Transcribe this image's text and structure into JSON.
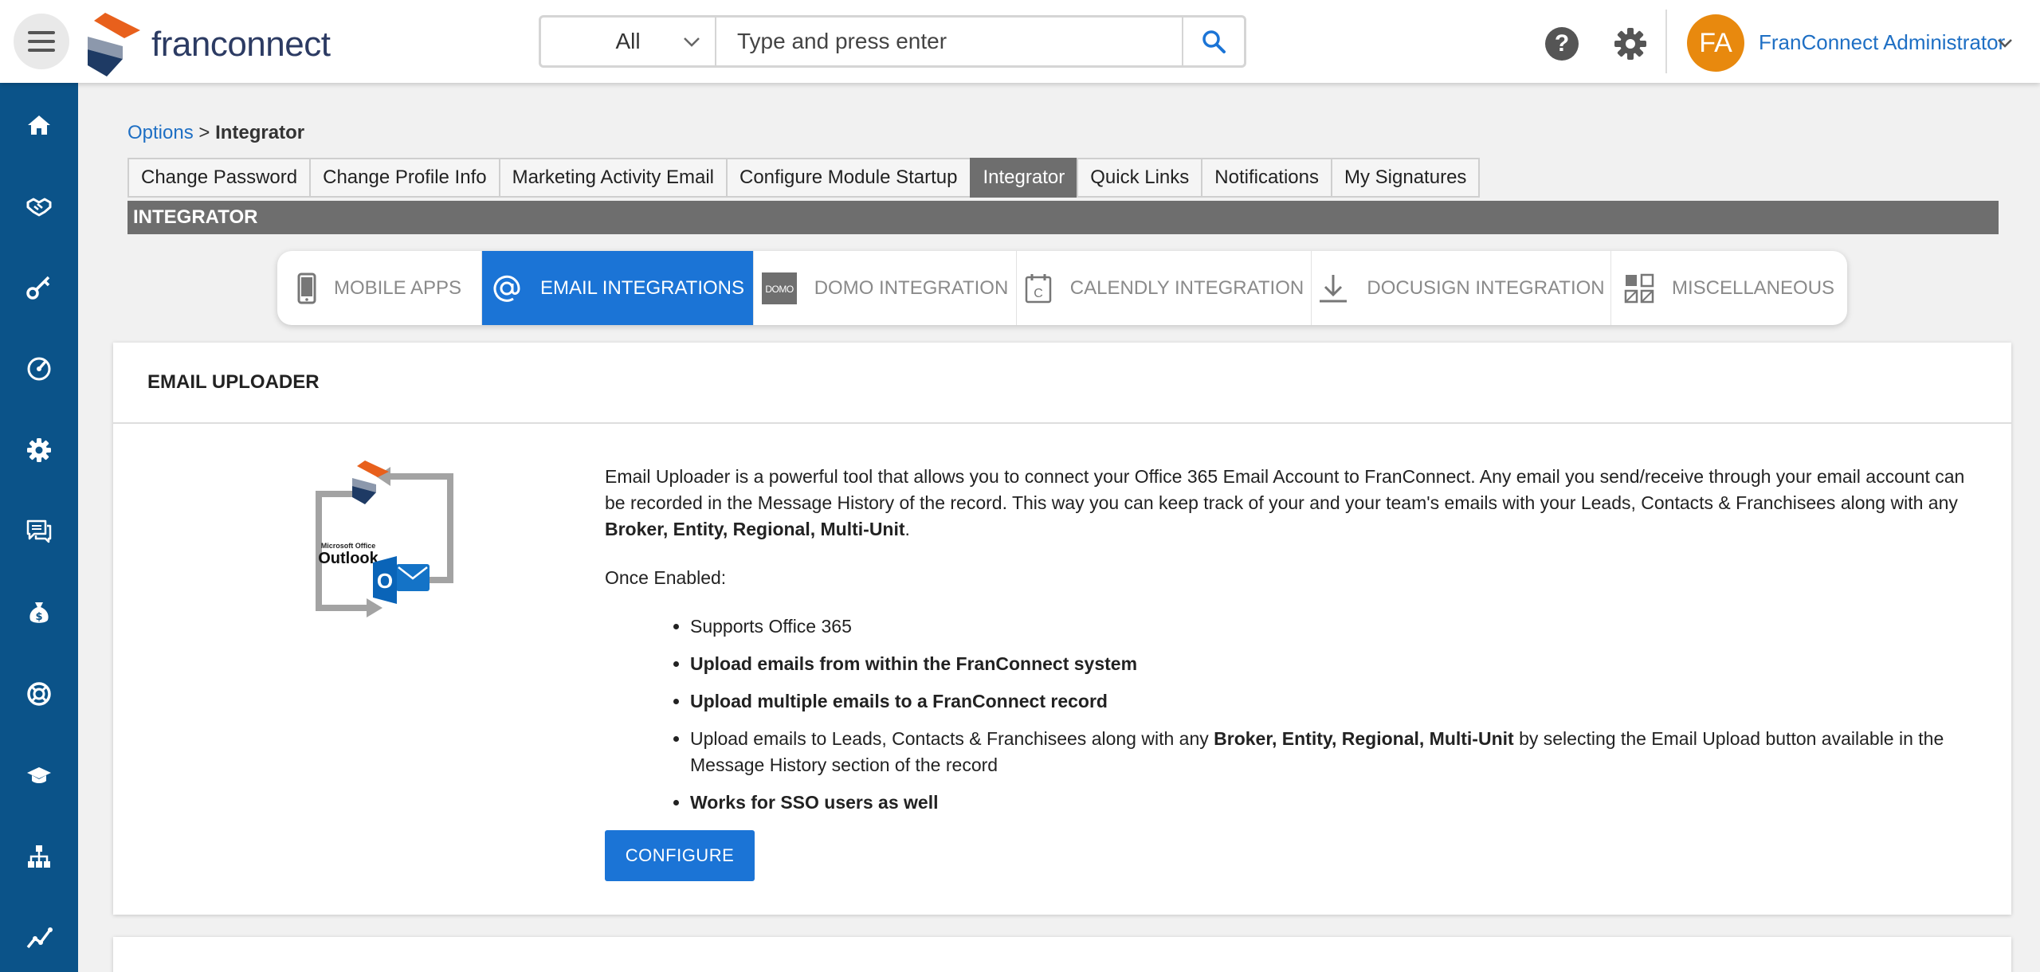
{
  "header": {
    "logo_text": "franconnect",
    "search": {
      "scope_value": "All",
      "placeholder": "Type and press enter"
    },
    "user": {
      "initials": "FA",
      "name": "FranConnect Administrator",
      "avatar_color": "#e8890e"
    }
  },
  "sidebar": {
    "color": "#0b5389",
    "items": [
      {
        "icon": "home-icon"
      },
      {
        "icon": "handshake-icon"
      },
      {
        "icon": "key-icon"
      },
      {
        "icon": "dashboard-gauge-icon"
      },
      {
        "icon": "gear-icon"
      },
      {
        "icon": "chat-icon"
      },
      {
        "icon": "money-bag-icon"
      },
      {
        "icon": "support-lifebuoy-icon"
      },
      {
        "icon": "graduation-cap-icon"
      },
      {
        "icon": "org-chart-icon"
      },
      {
        "icon": "line-chart-icon"
      }
    ]
  },
  "breadcrumb": {
    "parent": "Options",
    "separator": ">",
    "current": "Integrator"
  },
  "tabs": [
    {
      "label": "Change Password",
      "active": false
    },
    {
      "label": "Change Profile Info",
      "active": false
    },
    {
      "label": "Marketing Activity Email",
      "active": false
    },
    {
      "label": "Configure Module Startup",
      "active": false
    },
    {
      "label": "Integrator",
      "active": true
    },
    {
      "label": "Quick Links",
      "active": false
    },
    {
      "label": "Notifications",
      "active": false
    },
    {
      "label": "My Signatures",
      "active": false
    }
  ],
  "section_title": "INTEGRATOR",
  "integration_tabs": [
    {
      "label": "MOBILE APPS",
      "icon": "mobile-phone-icon",
      "active": false
    },
    {
      "label": "EMAIL INTEGRATIONS",
      "icon": "at-sign-icon",
      "active": true
    },
    {
      "label": "DOMO INTEGRATION",
      "icon": "domo-logo-icon",
      "active": false
    },
    {
      "label": "CALENDLY INTEGRATION",
      "icon": "calendar-icon",
      "active": false
    },
    {
      "label": "DOCUSIGN INTEGRATION",
      "icon": "download-icon",
      "active": false
    },
    {
      "label": "MISCELLANEOUS",
      "icon": "grid-icon",
      "active": false
    }
  ],
  "email_uploader": {
    "title": "EMAIL UPLOADER",
    "illustration": {
      "brand_line": "Microsoft Office",
      "product": "Outlook",
      "badge_letter": "O"
    },
    "intro_text": "Email Uploader is a powerful tool that allows you to connect your Office 365 Email Account to FranConnect. Any email you send/receive through your email account can be recorded in the Message History of the record. This way you can keep track of your and your team's emails with your Leads, Contacts & Franchisees along with any ",
    "intro_bold": "Broker, Entity, Regional, Multi-Unit",
    "intro_end": ".",
    "once_enabled": "Once Enabled:",
    "bullets": {
      "b1": "Supports Office 365",
      "b2": "Upload emails from within the FranConnect system",
      "b3": "Upload multiple emails to a FranConnect record",
      "b4_pre": "Upload emails to Leads, Contacts & Franchisees along with any ",
      "b4_bold": "Broker, Entity, Regional, Multi-Unit",
      "b4_post": " by selecting the Email Upload button available in the Message History section of the record",
      "b5": "Works for SSO users as well"
    },
    "configure_label": "CONFIGURE"
  },
  "colors": {
    "primary": "#1b74d6",
    "link": "#1e6fc4",
    "section_bar": "#6e6e6e"
  }
}
